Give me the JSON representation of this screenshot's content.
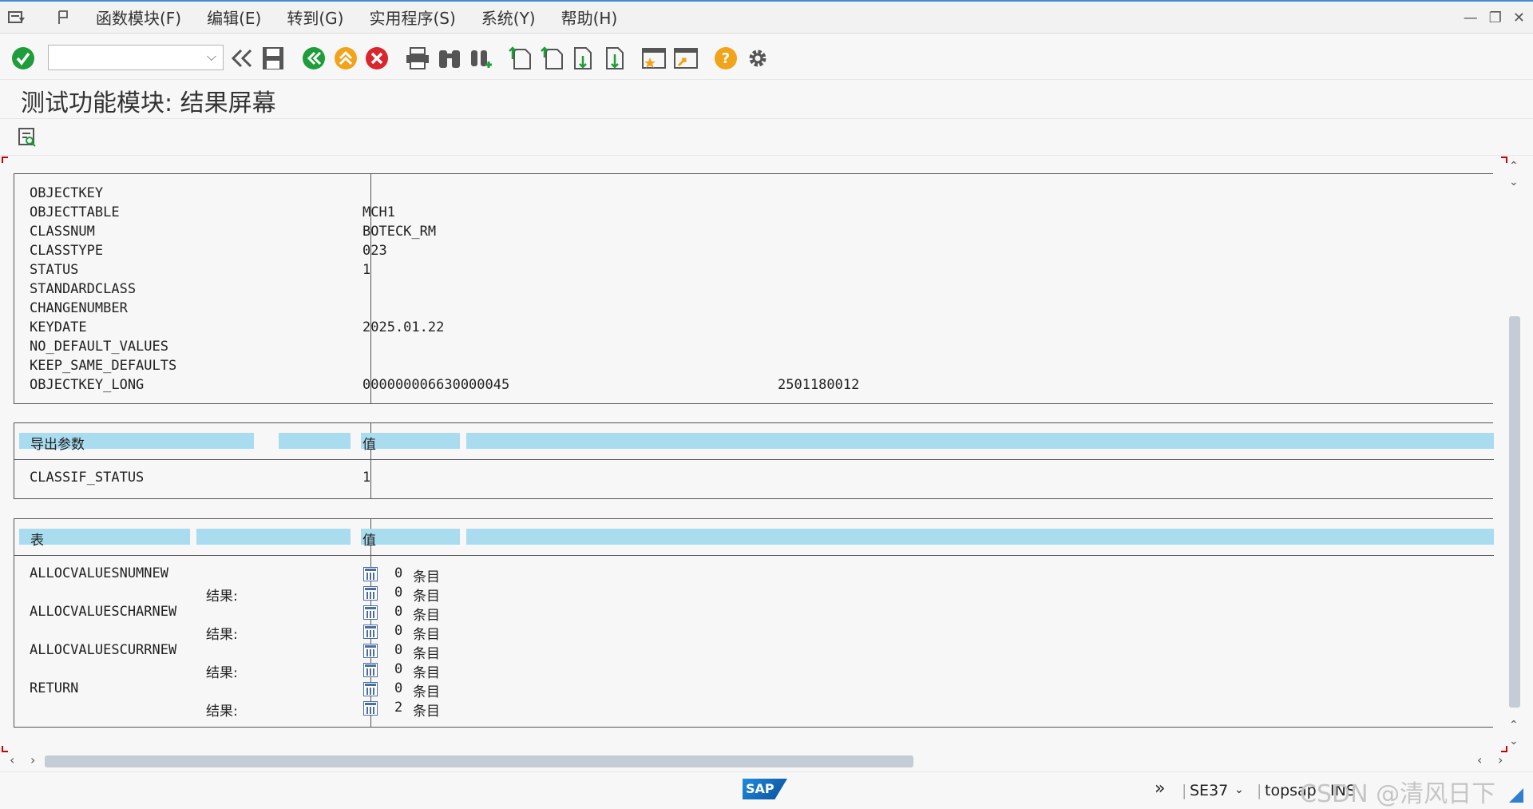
{
  "menu": {
    "items": [
      "函数模块(F)",
      "编辑(E)",
      "转到(G)",
      "实用程序(S)",
      "系统(Y)",
      "帮助(H)"
    ]
  },
  "toolbar": {
    "command_field_value": ""
  },
  "page": {
    "title": "测试功能模块: 结果屏幕"
  },
  "import_params": [
    {
      "name": "OBJECTKEY",
      "value": ""
    },
    {
      "name": "OBJECTTABLE",
      "value": "MCH1"
    },
    {
      "name": "CLASSNUM",
      "value": "BOTECK_RM"
    },
    {
      "name": "CLASSTYPE",
      "value": "023"
    },
    {
      "name": "STATUS",
      "value": "1"
    },
    {
      "name": "STANDARDCLASS",
      "value": ""
    },
    {
      "name": "CHANGENUMBER",
      "value": ""
    },
    {
      "name": "KEYDATE",
      "value": "2025.01.22"
    },
    {
      "name": "NO_DEFAULT_VALUES",
      "value": ""
    },
    {
      "name": "KEEP_SAME_DEFAULTS",
      "value": ""
    },
    {
      "name": "OBJECTKEY_LONG",
      "value": "000000006630000045",
      "value2": "2501180012"
    }
  ],
  "export": {
    "header_label": "导出参数",
    "value_header": "值",
    "params": [
      {
        "name": "CLASSIF_STATUS",
        "value": "1"
      }
    ]
  },
  "tables": {
    "header_label": "表",
    "value_header": "值",
    "result_label": "结果:",
    "entries_label": "条目",
    "rows": [
      {
        "name": "ALLOCVALUESNUMNEW",
        "count": "0",
        "result_count": "0"
      },
      {
        "name": "ALLOCVALUESCHARNEW",
        "count": "0",
        "result_count": "0"
      },
      {
        "name": "ALLOCVALUESCURRNEW",
        "count": "0",
        "result_count": "0"
      },
      {
        "name": "RETURN",
        "count": "0",
        "result_count": "2"
      }
    ]
  },
  "status": {
    "logo": "SAP",
    "transaction": "SE37",
    "server": "topsap",
    "mode": "INS",
    "watermark": "CSDN @清风日下"
  }
}
